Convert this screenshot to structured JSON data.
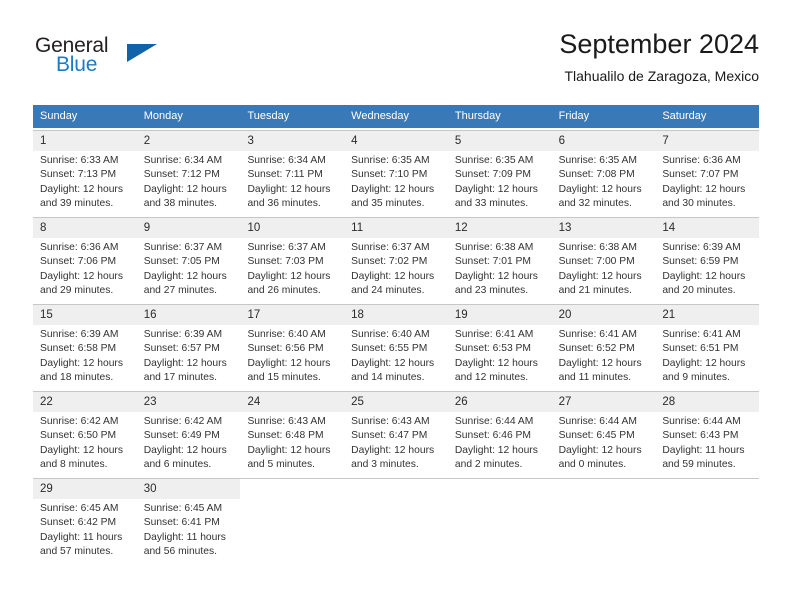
{
  "brand": {
    "word_one": "General",
    "word_two": "Blue",
    "triangle_color": "#1063a8"
  },
  "header": {
    "title": "September 2024",
    "subtitle": "Tlahualilo de Zaragoza, Mexico"
  },
  "colors": {
    "header_blue": "#3a79b8",
    "daynum_band": "#efefef",
    "grid_line": "#c7c7c7"
  },
  "weekdays": [
    "Sunday",
    "Monday",
    "Tuesday",
    "Wednesday",
    "Thursday",
    "Friday",
    "Saturday"
  ],
  "weeks": [
    [
      {
        "day": "1",
        "sunrise": "Sunrise: 6:33 AM",
        "sunset": "Sunset: 7:13 PM",
        "daylight1": "Daylight: 12 hours",
        "daylight2": "and 39 minutes."
      },
      {
        "day": "2",
        "sunrise": "Sunrise: 6:34 AM",
        "sunset": "Sunset: 7:12 PM",
        "daylight1": "Daylight: 12 hours",
        "daylight2": "and 38 minutes."
      },
      {
        "day": "3",
        "sunrise": "Sunrise: 6:34 AM",
        "sunset": "Sunset: 7:11 PM",
        "daylight1": "Daylight: 12 hours",
        "daylight2": "and 36 minutes."
      },
      {
        "day": "4",
        "sunrise": "Sunrise: 6:35 AM",
        "sunset": "Sunset: 7:10 PM",
        "daylight1": "Daylight: 12 hours",
        "daylight2": "and 35 minutes."
      },
      {
        "day": "5",
        "sunrise": "Sunrise: 6:35 AM",
        "sunset": "Sunset: 7:09 PM",
        "daylight1": "Daylight: 12 hours",
        "daylight2": "and 33 minutes."
      },
      {
        "day": "6",
        "sunrise": "Sunrise: 6:35 AM",
        "sunset": "Sunset: 7:08 PM",
        "daylight1": "Daylight: 12 hours",
        "daylight2": "and 32 minutes."
      },
      {
        "day": "7",
        "sunrise": "Sunrise: 6:36 AM",
        "sunset": "Sunset: 7:07 PM",
        "daylight1": "Daylight: 12 hours",
        "daylight2": "and 30 minutes."
      }
    ],
    [
      {
        "day": "8",
        "sunrise": "Sunrise: 6:36 AM",
        "sunset": "Sunset: 7:06 PM",
        "daylight1": "Daylight: 12 hours",
        "daylight2": "and 29 minutes."
      },
      {
        "day": "9",
        "sunrise": "Sunrise: 6:37 AM",
        "sunset": "Sunset: 7:05 PM",
        "daylight1": "Daylight: 12 hours",
        "daylight2": "and 27 minutes."
      },
      {
        "day": "10",
        "sunrise": "Sunrise: 6:37 AM",
        "sunset": "Sunset: 7:03 PM",
        "daylight1": "Daylight: 12 hours",
        "daylight2": "and 26 minutes."
      },
      {
        "day": "11",
        "sunrise": "Sunrise: 6:37 AM",
        "sunset": "Sunset: 7:02 PM",
        "daylight1": "Daylight: 12 hours",
        "daylight2": "and 24 minutes."
      },
      {
        "day": "12",
        "sunrise": "Sunrise: 6:38 AM",
        "sunset": "Sunset: 7:01 PM",
        "daylight1": "Daylight: 12 hours",
        "daylight2": "and 23 minutes."
      },
      {
        "day": "13",
        "sunrise": "Sunrise: 6:38 AM",
        "sunset": "Sunset: 7:00 PM",
        "daylight1": "Daylight: 12 hours",
        "daylight2": "and 21 minutes."
      },
      {
        "day": "14",
        "sunrise": "Sunrise: 6:39 AM",
        "sunset": "Sunset: 6:59 PM",
        "daylight1": "Daylight: 12 hours",
        "daylight2": "and 20 minutes."
      }
    ],
    [
      {
        "day": "15",
        "sunrise": "Sunrise: 6:39 AM",
        "sunset": "Sunset: 6:58 PM",
        "daylight1": "Daylight: 12 hours",
        "daylight2": "and 18 minutes."
      },
      {
        "day": "16",
        "sunrise": "Sunrise: 6:39 AM",
        "sunset": "Sunset: 6:57 PM",
        "daylight1": "Daylight: 12 hours",
        "daylight2": "and 17 minutes."
      },
      {
        "day": "17",
        "sunrise": "Sunrise: 6:40 AM",
        "sunset": "Sunset: 6:56 PM",
        "daylight1": "Daylight: 12 hours",
        "daylight2": "and 15 minutes."
      },
      {
        "day": "18",
        "sunrise": "Sunrise: 6:40 AM",
        "sunset": "Sunset: 6:55 PM",
        "daylight1": "Daylight: 12 hours",
        "daylight2": "and 14 minutes."
      },
      {
        "day": "19",
        "sunrise": "Sunrise: 6:41 AM",
        "sunset": "Sunset: 6:53 PM",
        "daylight1": "Daylight: 12 hours",
        "daylight2": "and 12 minutes."
      },
      {
        "day": "20",
        "sunrise": "Sunrise: 6:41 AM",
        "sunset": "Sunset: 6:52 PM",
        "daylight1": "Daylight: 12 hours",
        "daylight2": "and 11 minutes."
      },
      {
        "day": "21",
        "sunrise": "Sunrise: 6:41 AM",
        "sunset": "Sunset: 6:51 PM",
        "daylight1": "Daylight: 12 hours",
        "daylight2": "and 9 minutes."
      }
    ],
    [
      {
        "day": "22",
        "sunrise": "Sunrise: 6:42 AM",
        "sunset": "Sunset: 6:50 PM",
        "daylight1": "Daylight: 12 hours",
        "daylight2": "and 8 minutes."
      },
      {
        "day": "23",
        "sunrise": "Sunrise: 6:42 AM",
        "sunset": "Sunset: 6:49 PM",
        "daylight1": "Daylight: 12 hours",
        "daylight2": "and 6 minutes."
      },
      {
        "day": "24",
        "sunrise": "Sunrise: 6:43 AM",
        "sunset": "Sunset: 6:48 PM",
        "daylight1": "Daylight: 12 hours",
        "daylight2": "and 5 minutes."
      },
      {
        "day": "25",
        "sunrise": "Sunrise: 6:43 AM",
        "sunset": "Sunset: 6:47 PM",
        "daylight1": "Daylight: 12 hours",
        "daylight2": "and 3 minutes."
      },
      {
        "day": "26",
        "sunrise": "Sunrise: 6:44 AM",
        "sunset": "Sunset: 6:46 PM",
        "daylight1": "Daylight: 12 hours",
        "daylight2": "and 2 minutes."
      },
      {
        "day": "27",
        "sunrise": "Sunrise: 6:44 AM",
        "sunset": "Sunset: 6:45 PM",
        "daylight1": "Daylight: 12 hours",
        "daylight2": "and 0 minutes."
      },
      {
        "day": "28",
        "sunrise": "Sunrise: 6:44 AM",
        "sunset": "Sunset: 6:43 PM",
        "daylight1": "Daylight: 11 hours",
        "daylight2": "and 59 minutes."
      }
    ],
    [
      {
        "day": "29",
        "sunrise": "Sunrise: 6:45 AM",
        "sunset": "Sunset: 6:42 PM",
        "daylight1": "Daylight: 11 hours",
        "daylight2": "and 57 minutes."
      },
      {
        "day": "30",
        "sunrise": "Sunrise: 6:45 AM",
        "sunset": "Sunset: 6:41 PM",
        "daylight1": "Daylight: 11 hours",
        "daylight2": "and 56 minutes."
      },
      {
        "day": "",
        "sunrise": "",
        "sunset": "",
        "daylight1": "",
        "daylight2": ""
      },
      {
        "day": "",
        "sunrise": "",
        "sunset": "",
        "daylight1": "",
        "daylight2": ""
      },
      {
        "day": "",
        "sunrise": "",
        "sunset": "",
        "daylight1": "",
        "daylight2": ""
      },
      {
        "day": "",
        "sunrise": "",
        "sunset": "",
        "daylight1": "",
        "daylight2": ""
      },
      {
        "day": "",
        "sunrise": "",
        "sunset": "",
        "daylight1": "",
        "daylight2": ""
      }
    ]
  ]
}
